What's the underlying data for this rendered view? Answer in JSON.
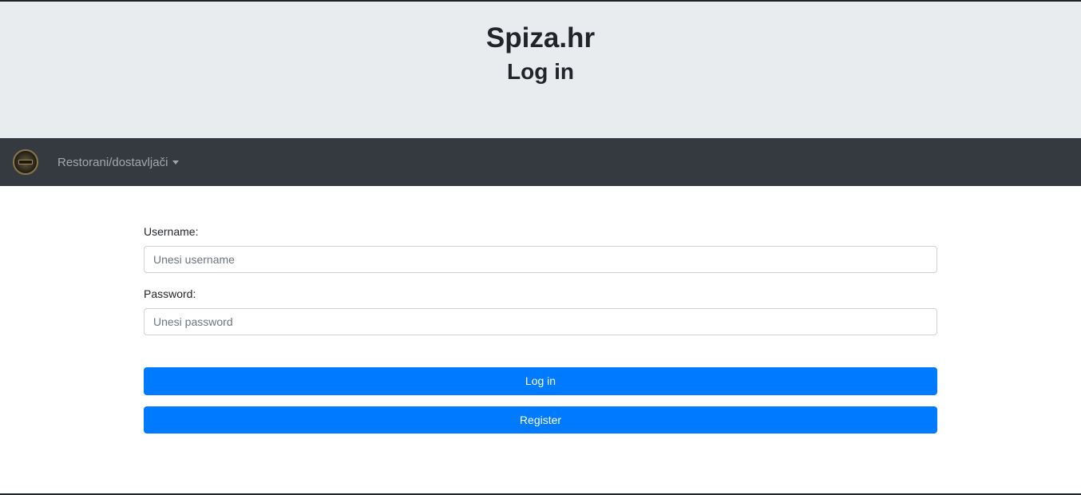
{
  "header": {
    "site_title": "Spiza.hr",
    "page_title": "Log in"
  },
  "navbar": {
    "logo_icon": "restaurant-logo-icon",
    "dropdown_label": "Restorani/dostavljači"
  },
  "form": {
    "username_label": "Username:",
    "username_placeholder": "Unesi username",
    "username_value": "",
    "password_label": "Password:",
    "password_placeholder": "Unesi password",
    "password_value": "",
    "login_label": "Log in",
    "register_label": "Register"
  },
  "colors": {
    "header_bg": "#e9ecef",
    "navbar_bg": "#343a40",
    "primary": "#007bff"
  }
}
